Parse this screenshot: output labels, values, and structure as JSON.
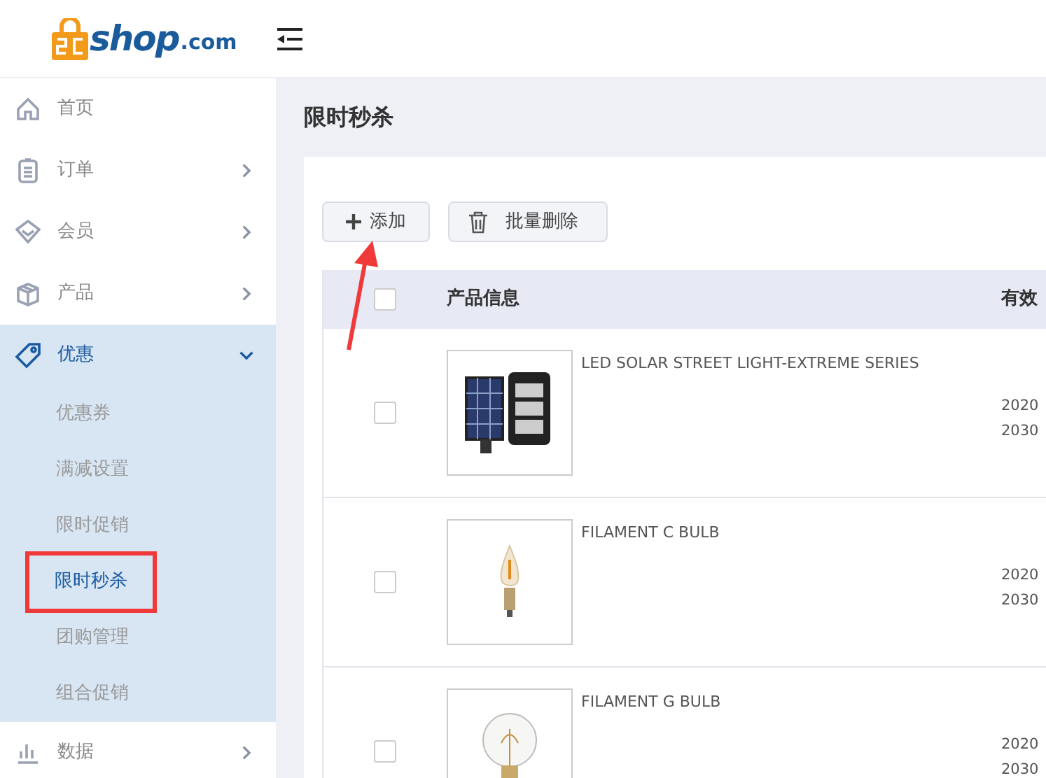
{
  "logo": {
    "text": "shop",
    "suffix": ".com"
  },
  "sidebar": {
    "items": [
      {
        "label": "首页",
        "selected": false
      },
      {
        "label": "订单",
        "expanded": false,
        "selected": false
      },
      {
        "label": "会员",
        "expanded": false,
        "selected": false
      },
      {
        "label": "产品",
        "expanded": false,
        "selected": false
      },
      {
        "label": "优惠",
        "expanded": true,
        "selected": true,
        "children": [
          {
            "label": "优惠券",
            "selected": false,
            "highlighted": false
          },
          {
            "label": "满减设置",
            "selected": false,
            "highlighted": false
          },
          {
            "label": "限时促销",
            "selected": false,
            "highlighted": false
          },
          {
            "label": "限时秒杀",
            "selected": true,
            "highlighted": true
          },
          {
            "label": "团购管理",
            "selected": false,
            "highlighted": false
          },
          {
            "label": "组合促销",
            "selected": false,
            "highlighted": false
          }
        ]
      },
      {
        "label": "数据",
        "expanded": false,
        "selected": false
      }
    ]
  },
  "page_title": "限时秒杀",
  "toolbar": {
    "buttons": [
      {
        "label": "添加"
      },
      {
        "label": "批量删除"
      }
    ],
    "annotation_arrow": true
  },
  "table": {
    "columns": [
      "产品信息",
      "有效"
    ],
    "header_checked": false,
    "rows": [
      {
        "checked": false,
        "name": "LED SOLAR STREET LIGHT-EXTREME SERIES",
        "dates": [
          "2020",
          "2030"
        ]
      },
      {
        "checked": false,
        "name": "FILAMENT C BULB",
        "dates": [
          "2020",
          "2030"
        ]
      },
      {
        "checked": false,
        "name": "FILAMENT G BULB",
        "dates": [
          "2020",
          "2030"
        ]
      }
    ]
  }
}
